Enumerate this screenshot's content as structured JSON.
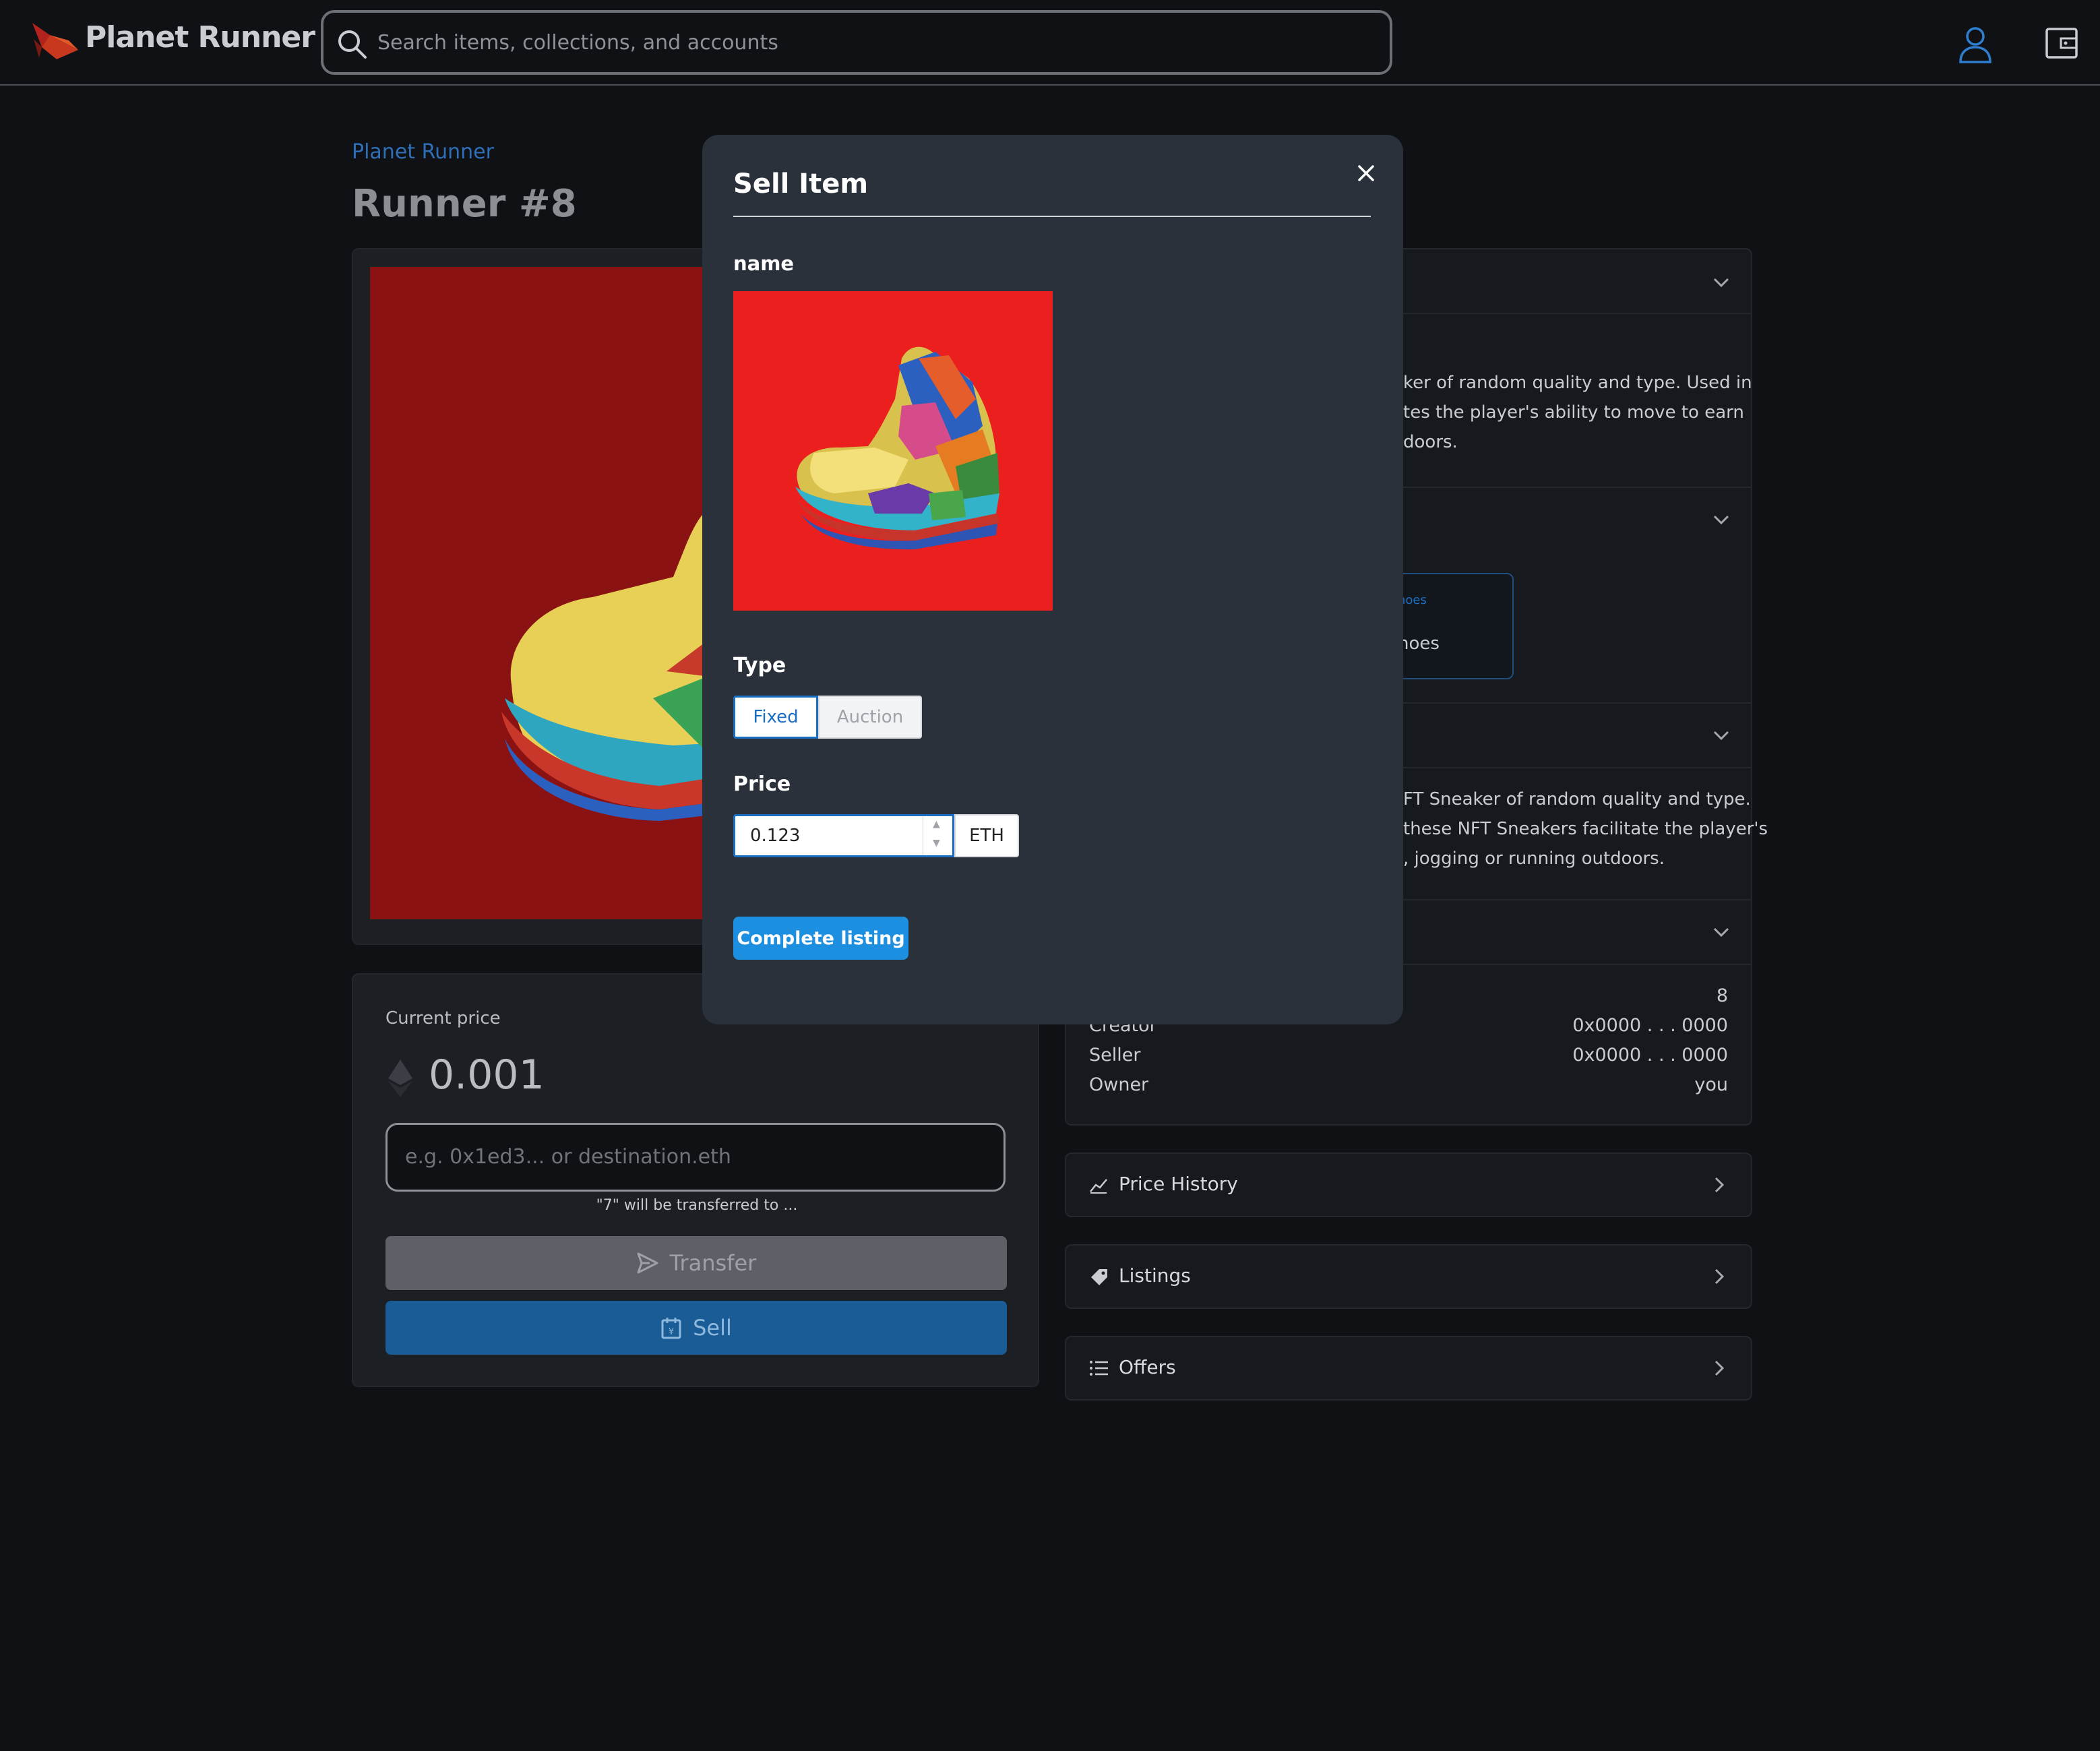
{
  "header": {
    "brand": "Planet Runner",
    "search_placeholder": "Search items, collections, and accounts"
  },
  "page": {
    "collection": "Planet Runner",
    "title": "Runner #8"
  },
  "price_panel": {
    "current_price_label": "Current price",
    "current_price": "0.001",
    "destination_placeholder": "e.g. 0x1ed3... or destination.eth",
    "transfer_note": "\"7\" will be transferred to ...",
    "transfer_label": "Transfer",
    "sell_label": "Sell"
  },
  "details_partial": {
    "description_lines": [
      "ker of random quality and type. Used in",
      "tes the player's ability to move to earn",
      "doors."
    ],
    "property_type": "hoes",
    "property_value": "hoes",
    "about_lines": [
      "FT Sneaker of random quality and type.",
      "these NFT Sneakers facilitate the player's",
      ", jogging or running outdoors."
    ],
    "token_id_value": "8",
    "rows": [
      {
        "label": "Creator",
        "value": "0x0000 . . . 0000"
      },
      {
        "label": "Seller",
        "value": "0x0000 . . . 0000"
      },
      {
        "label": "Owner",
        "value": "you"
      }
    ]
  },
  "side_panels": {
    "price_history": "Price History",
    "listings": "Listings",
    "offers": "Offers"
  },
  "modal": {
    "title": "Sell Item",
    "name_label": "name",
    "type_label": "Type",
    "type_options": [
      "Fixed",
      "Auction"
    ],
    "type_selected": "Fixed",
    "price_label": "Price",
    "price_value": "0.123",
    "currency": "ETH",
    "submit_label": "Complete listing"
  },
  "colors": {
    "background": "#0f1114",
    "modal": "#2a313a",
    "accent_blue": "#1d8fe0",
    "sell_button": "#1a5c96",
    "nft_red": "#ec1f1f"
  }
}
